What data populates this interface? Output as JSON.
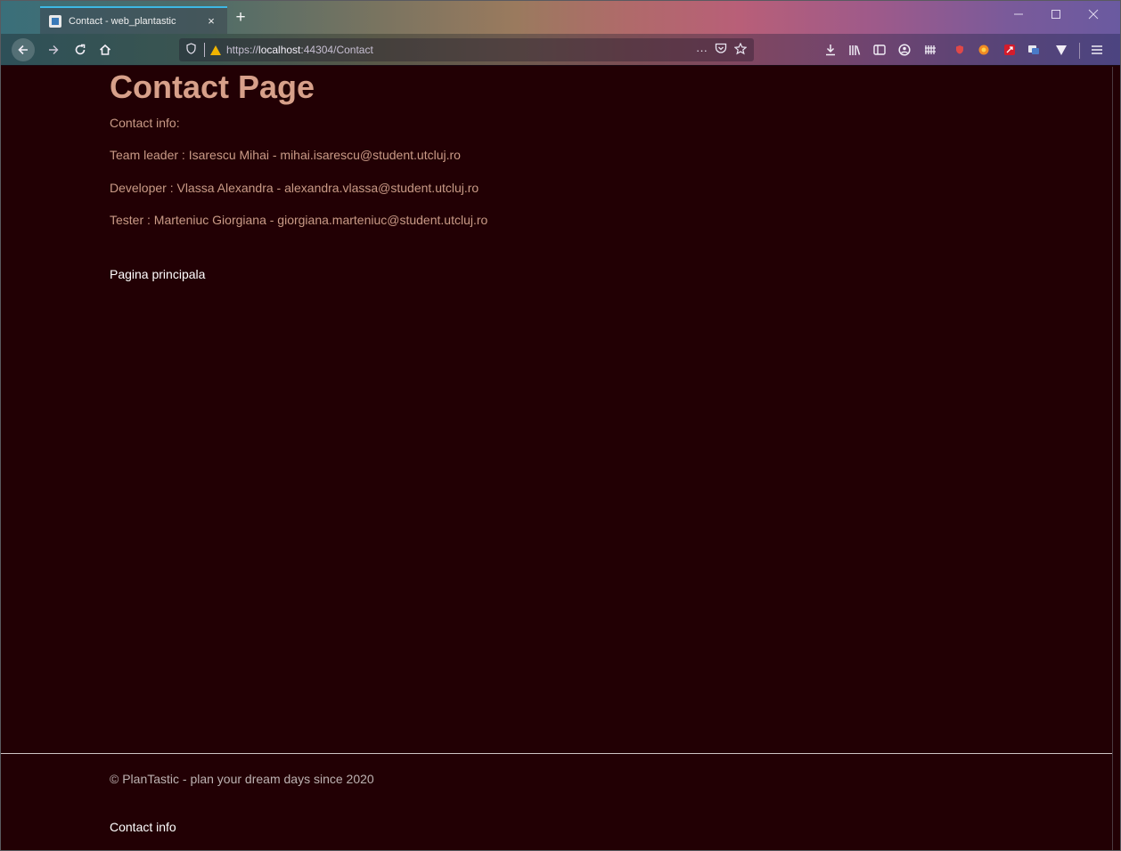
{
  "browser": {
    "tab_title": "Contact - web_plantastic",
    "tab_close": "×",
    "new_tab": "+",
    "url_protocol": "https://",
    "url_host": "localhost",
    "url_rest": ":44304/Contact",
    "page_actions": "···"
  },
  "page": {
    "title": "Contact Page",
    "contact_label": "Contact info:",
    "team": [
      "Team leader : Isarescu Mihai - mihai.isarescu@student.utcluj.ro",
      "Developer : Vlassa Alexandra - alexandra.vlassa@student.utcluj.ro",
      "Tester : Marteniuc Giorgiana - giorgiana.marteniuc@student.utcluj.ro"
    ],
    "home_link": "Pagina principala"
  },
  "footer": {
    "copyright": "© PlanTastic - plan your dream days since 2020",
    "contact_link": "Contact info"
  },
  "icons": {
    "back": "back-arrow-icon",
    "forward": "forward-arrow-icon",
    "reload": "reload-icon",
    "home": "home-icon",
    "shield": "tracking-shield-icon",
    "warning": "insecure-warning-icon",
    "pocket": "pocket-icon",
    "bookmark": "bookmark-star-icon",
    "download": "download-icon",
    "library": "library-icon",
    "sidebar": "sidebar-icon",
    "account": "account-icon",
    "menu": "hamburger-menu-icon"
  },
  "colors": {
    "page_bg": "#220004",
    "title": "#d7a08a",
    "text": "#c99a86",
    "link": "#ffffff"
  }
}
